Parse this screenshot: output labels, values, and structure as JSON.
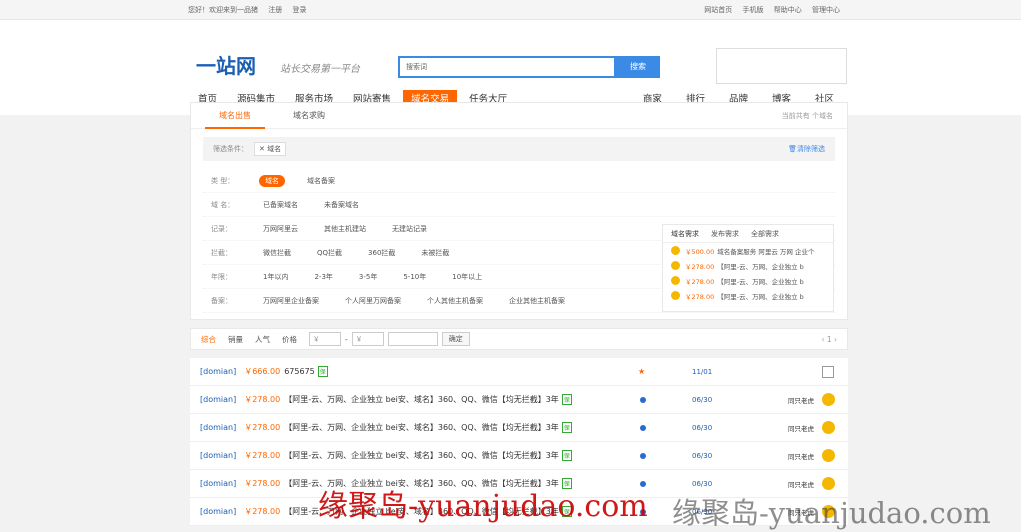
{
  "topbar": {
    "greeting": "您好！欢迎来到一品猪",
    "register": "注册",
    "login": "登录",
    "links": [
      "网站首页",
      "手机版",
      "帮助中心",
      "管理中心"
    ]
  },
  "header": {
    "logo": "一站网",
    "slogan": "站长交易第一平台",
    "search_placeholder": "搜索词",
    "search_button": "搜索"
  },
  "nav": {
    "items": [
      "首页",
      "源码集市",
      "服务市场",
      "网站寄售",
      "域名交易",
      "任务大厅"
    ],
    "right": [
      "商家",
      "排行",
      "品牌",
      "博客",
      "社区"
    ]
  },
  "tabs": {
    "items": [
      "域名出售",
      "域名求购"
    ],
    "count_text": "当前共有 个域名"
  },
  "filter": {
    "label": "筛选条件：",
    "chip": "域名",
    "clear": "清除筛选"
  },
  "filters": [
    {
      "label": "类  型：",
      "options": [
        "域名",
        "域名备案"
      ]
    },
    {
      "label": "域  名：",
      "options": [
        "已备案域名",
        "未备案域名"
      ]
    },
    {
      "label": "记录：",
      "options": [
        "万网阿里云",
        "其他主机建站",
        "无建站记录"
      ]
    },
    {
      "label": "拦截：",
      "options": [
        "微信拦截",
        "QQ拦截",
        "360拦截",
        "未被拦截"
      ]
    },
    {
      "label": "年限：",
      "options": [
        "1年以内",
        "2-3年",
        "3-5年",
        "5-10年",
        "10年以上"
      ]
    },
    {
      "label": "备案：",
      "options": [
        "万网阿里企业备案",
        "个人阿里万网备案",
        "个人其他主机备案",
        "企业其他主机备案"
      ]
    }
  ],
  "side": {
    "title": "域名需求",
    "publish": "发布需求",
    "all": "全部需求",
    "lines": [
      {
        "price": "￥500.00",
        "text": "域名备案服务 阿里云 万网 企业个"
      },
      {
        "price": "￥278.00",
        "text": "【阿里-云、万网、企业独立 b"
      },
      {
        "price": "￥278.00",
        "text": "【阿里-云、万网、企业独立 b"
      },
      {
        "price": "￥278.00",
        "text": "【阿里-云、万网、企业独立 b"
      }
    ]
  },
  "sort": {
    "items": [
      "综合",
      "销量",
      "人气",
      "价格"
    ],
    "yuan": "￥",
    "dash": "-",
    "confirm": "确定",
    "pager": "‹ 1 ›"
  },
  "list": [
    {
      "cat": "[domian]",
      "price": "￥666.00",
      "title": "675675",
      "date": "11/01",
      "status": ""
    },
    {
      "cat": "[domian]",
      "price": "￥278.00",
      "title": "【阿里-云、万网、企业独立 bei安、域名】360、QQ、微信【均无拦截】3年",
      "date": "06/30",
      "status": "同只老虎"
    },
    {
      "cat": "[domian]",
      "price": "￥278.00",
      "title": "【阿里-云、万网、企业独立 bei安、域名】360、QQ、微信【均无拦截】3年",
      "date": "06/30",
      "status": "同只老虎"
    },
    {
      "cat": "[domian]",
      "price": "￥278.00",
      "title": "【阿里-云、万网、企业独立 bei安、域名】360、QQ、微信【均无拦截】3年",
      "date": "06/30",
      "status": "同只老虎"
    },
    {
      "cat": "[domian]",
      "price": "￥278.00",
      "title": "【阿里-云、万网、企业独立 bei安、域名】360、QQ、微信【均无拦截】3年",
      "date": "06/30",
      "status": "同只老虎"
    },
    {
      "cat": "[domian]",
      "price": "￥278.00",
      "title": "【阿里-云、万网、企业独立 bei安、域名】360、QQ、微信【均无拦截】3年",
      "date": "06/30",
      "status": "同只老虎"
    }
  ],
  "bao": "保",
  "watermark": {
    "red": "缘聚岛-yuanjudao.com",
    "gray": "缘聚岛-yuanjudao.com"
  },
  "colors": {
    "accent": "#ff6600",
    "link": "#1a5fb4",
    "search": "#3b8ae6"
  }
}
